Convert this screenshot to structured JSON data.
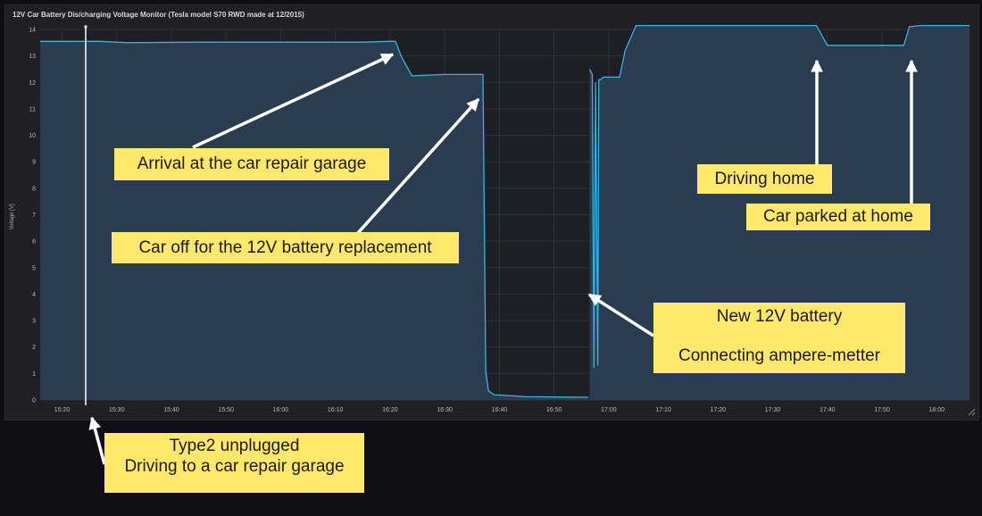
{
  "panel": {
    "title": "12V Car Battery Dis/charging Voltage Monitor (Tesla model S70 RWD made at 12/2015)"
  },
  "colors": {
    "background": "#0f0f13",
    "panel": "#1f1f24",
    "series_line": "#33b5e5",
    "area_fill": "#2b3f52",
    "note_fill": "#ffe86b",
    "arrow": "#ffffff"
  },
  "chart_data": {
    "type": "area",
    "ylabel": "Voltage [V]",
    "ylim": [
      0,
      14
    ],
    "yticks": [
      0,
      1,
      2,
      3,
      4,
      5,
      6,
      7,
      8,
      9,
      10,
      11,
      12,
      13,
      14
    ],
    "xlim": [
      "15:16",
      "18:06"
    ],
    "xticks": [
      "15:20",
      "15:30",
      "15:40",
      "15:50",
      "16:00",
      "16:10",
      "16:20",
      "16:30",
      "16:40",
      "16:50",
      "17:00",
      "17:10",
      "17:20",
      "17:30",
      "17:40",
      "17:50",
      "18:00"
    ],
    "grid": true,
    "series": [
      {
        "x": [
          "15:16",
          "15:27",
          "15:32",
          "15:45",
          "16:00",
          "16:15",
          "16:20",
          "16:21",
          "16:22",
          "16:24",
          "16:30",
          "16:36",
          "16:37",
          "16:37.5",
          "16:38",
          "16:39",
          "16:45",
          "16:56",
          "16:56.3"
        ],
        "values": [
          13.55,
          13.55,
          13.5,
          13.52,
          13.52,
          13.52,
          13.55,
          13.55,
          13.0,
          12.25,
          12.3,
          12.3,
          12.3,
          1.1,
          0.35,
          0.2,
          0.12,
          0.1,
          0.1
        ]
      },
      {
        "x": [
          "16:56.5",
          "16:57",
          "16:57.3",
          "16:57.6",
          "16:58",
          "16:58.2",
          "16:58.5",
          "16:59",
          "17:00",
          "17:02",
          "17:03",
          "17:05",
          "17:20",
          "17:35",
          "17:38",
          "17:40",
          "17:50",
          "17:54",
          "17:55",
          "17:57",
          "18:00",
          "18:06"
        ],
        "values": [
          12.5,
          12.3,
          1.2,
          12.0,
          1.3,
          12.1,
          12.1,
          12.2,
          12.2,
          12.2,
          13.2,
          14.15,
          14.15,
          14.15,
          14.15,
          13.4,
          13.4,
          13.4,
          14.1,
          14.15,
          14.15,
          14.15
        ]
      }
    ],
    "annotations": [
      {
        "text": "Arrival at the car repair garage"
      },
      {
        "text": "Car off for the 12V battery replacement"
      },
      {
        "text": "Driving home"
      },
      {
        "text": "Car parked at home"
      },
      {
        "text": "New 12V battery",
        "text2": "Connecting ampere-metter"
      },
      {
        "text": "Type2 unplugged",
        "text2": "Driving to a car repair garage"
      }
    ]
  }
}
